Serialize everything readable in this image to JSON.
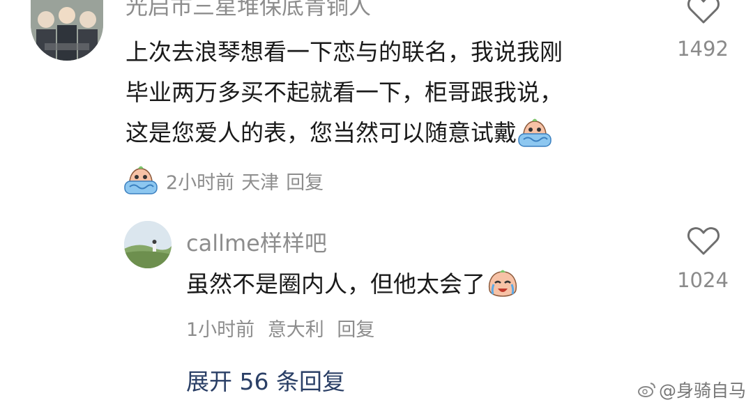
{
  "comment": {
    "username": "光启市三星堆保底青铜人",
    "text_lines": [
      "上次去浪琴想看一下恋与的联名，我说我刚",
      "毕业两万多买不起就看一下，柜哥跟我说，",
      "这是您爱人的表，您当然可以随意试戴"
    ],
    "time": "2小时前",
    "location": "天津",
    "reply_label": "回复",
    "likes": "1492"
  },
  "reply": {
    "username": "callme样样吧",
    "text": "虽然不是圈内人，但他太会了",
    "time": "1小时前",
    "location": "意大利",
    "reply_label": "回复",
    "likes": "1024"
  },
  "expand_label": "展开 56 条回复",
  "watermark": "@身骑自马",
  "icons": {
    "like": "heart-outline-icon",
    "crying": "crying-emoji-icon"
  },
  "colors": {
    "text": "#1a1a1a",
    "secondary": "#8d8d8d",
    "expand": "#2a3f66"
  }
}
